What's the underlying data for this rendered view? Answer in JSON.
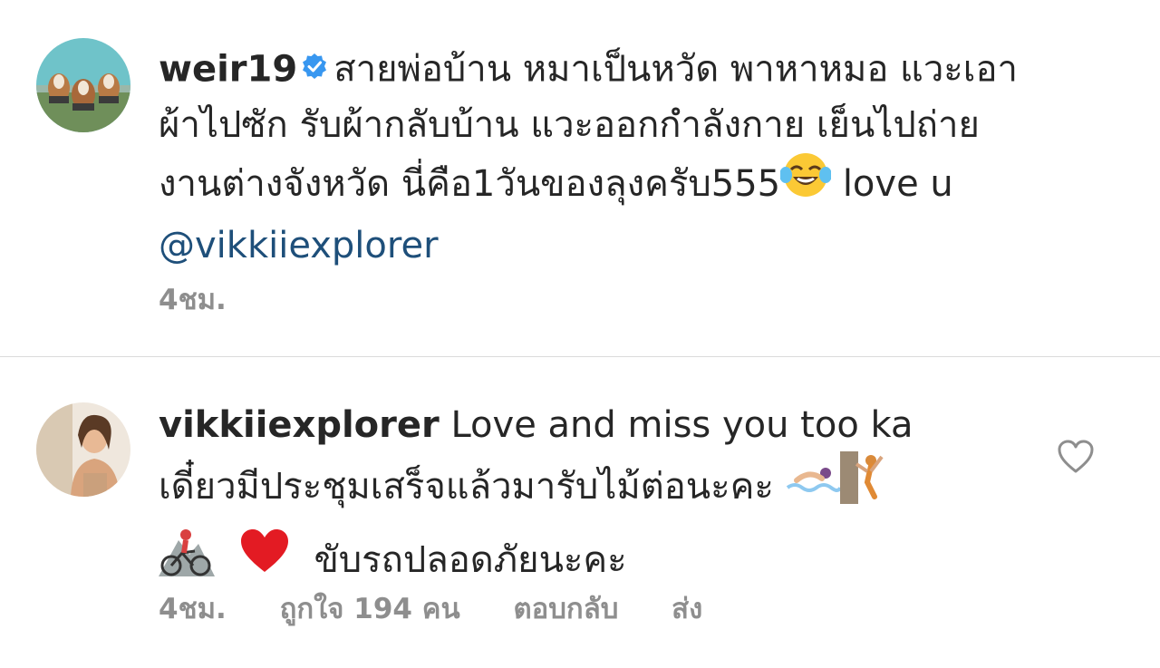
{
  "comments": [
    {
      "username": "weir19",
      "text_line1": "สายพ่อบ้าน หมาเป็นหวัด พาหาหมอ แวะเอา",
      "text_line2": "ผ้าไปซัก รับผ้ากลับบ้าน แวะออกกำลังกาย เย็นไปถ่าย",
      "text_line3_a": "งานต่างจังหวัด นี่คือ1วันของลุงครับ555",
      "text_line3_b": "love u",
      "mention": "@vikkiiexplorer",
      "time": "4ชม."
    },
    {
      "username": "vikkiiexplorer",
      "text_line1": "Love and miss you too ka",
      "text_line2": "เดี๋ยวมีประชุมเสร็จแล้วมารับไม้ต่อนะคะ",
      "text_line3": "ขับรถปลอดภัยนะคะ",
      "time": "4ชม.",
      "likes": "ถูกใจ 194 คน",
      "reply": "ตอบกลับ",
      "send": "ส่ง"
    }
  ],
  "icons": {
    "verified_color": "#3897f0",
    "heart_color": "#e31b23"
  }
}
